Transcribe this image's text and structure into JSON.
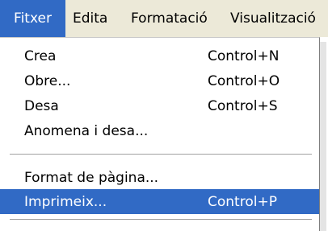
{
  "menubar": {
    "items": [
      {
        "label": "Fitxer"
      },
      {
        "label": "Edita"
      },
      {
        "label": "Formatació"
      },
      {
        "label": "Visualització"
      }
    ]
  },
  "file_menu": {
    "items": [
      {
        "label": "Crea",
        "shortcut": "Control+N"
      },
      {
        "label": "Obre...",
        "shortcut": "Control+O"
      },
      {
        "label": "Desa",
        "shortcut": "Control+S"
      },
      {
        "label": "Anomena i desa...",
        "shortcut": ""
      },
      {
        "label": "Format de pàgina...",
        "shortcut": ""
      },
      {
        "label": "Imprimeix...",
        "shortcut": "Control+P"
      }
    ]
  }
}
